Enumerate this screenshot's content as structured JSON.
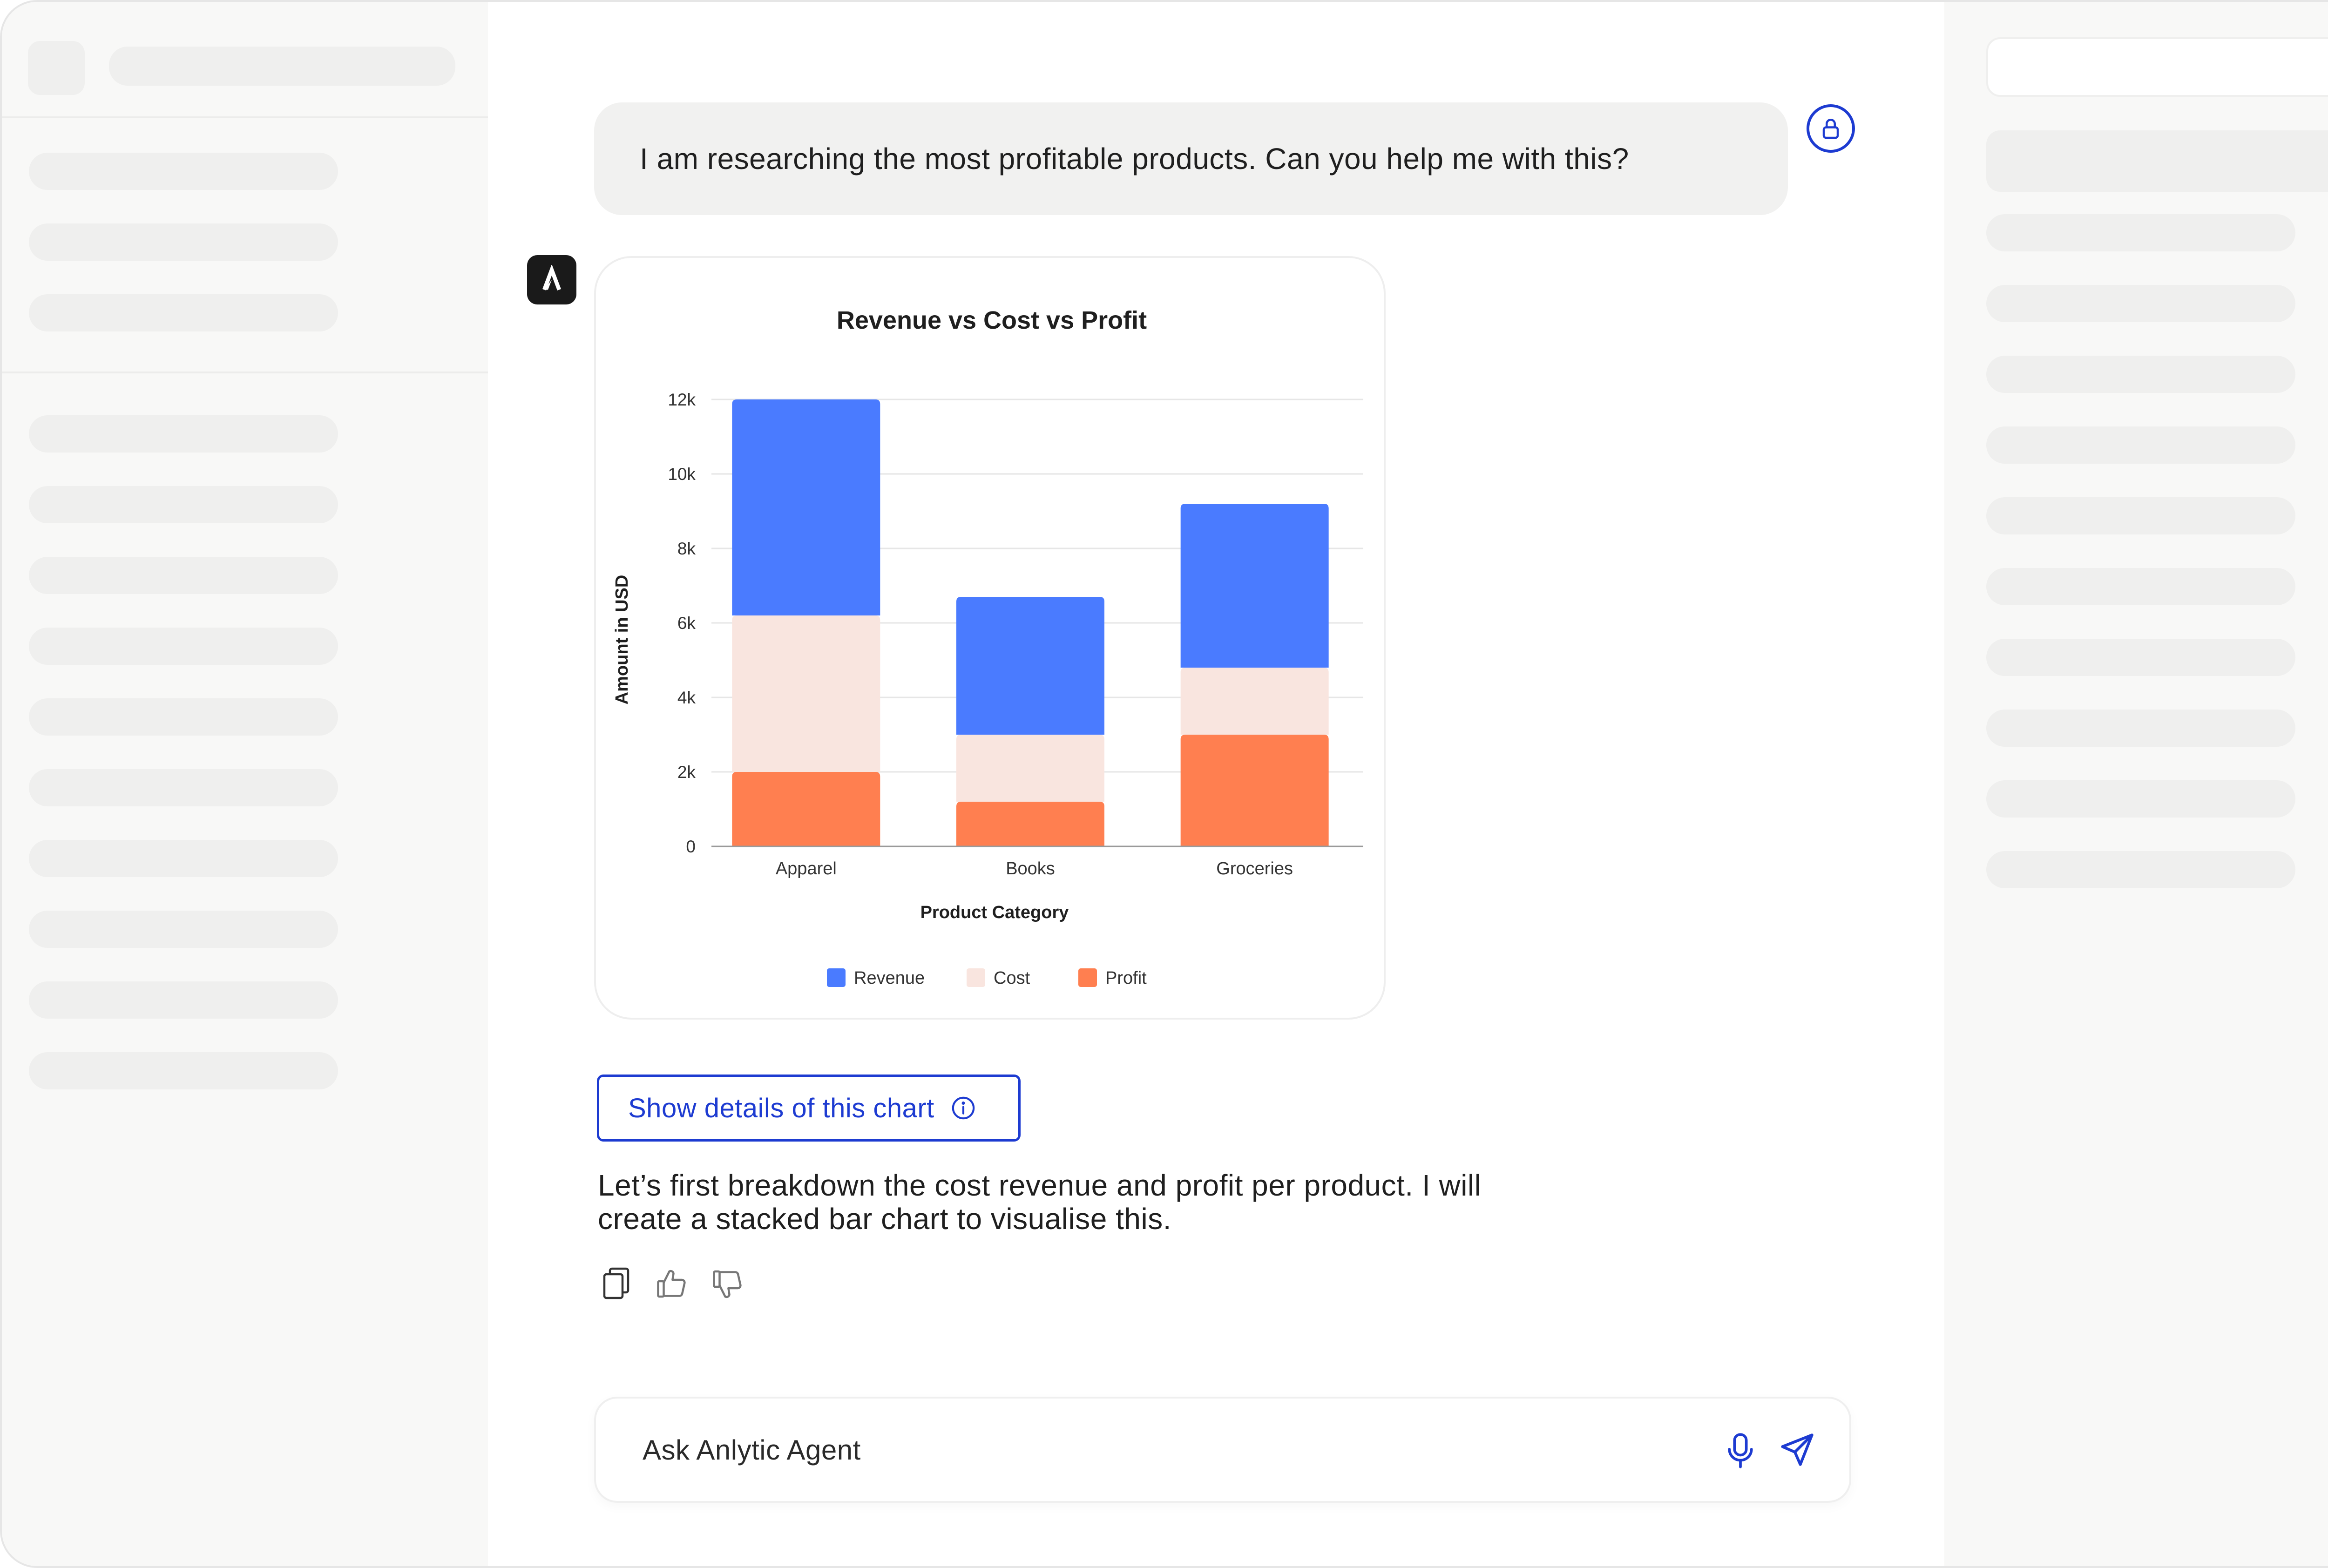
{
  "conversation": {
    "user_message": "I am researching the most profitable products. Can you help me with this?",
    "details_button_label": "Show details of this chart",
    "agent_response": "Let’s first breakdown the cost revenue and profit per product. I will create a stacked bar chart to visualise this."
  },
  "input": {
    "placeholder": "Ask Anlytic Agent"
  },
  "icons": {
    "user_avatar": "lock-user-icon",
    "agent_logo": "anlytic-logo-icon",
    "details_info": "info-icon",
    "copy": "copy-icon",
    "like": "thumbs-up-icon",
    "dislike": "thumbs-down-icon",
    "mic": "microphone-icon",
    "send": "send-icon"
  },
  "colors": {
    "accent": "#1d3bd1",
    "revenue": "#4a7bff",
    "cost": "#f9e5df",
    "profit": "#ff7f50"
  },
  "chart_data": {
    "type": "bar",
    "stacked": true,
    "title": "Revenue vs Cost vs Profit",
    "xlabel": "Product Category",
    "ylabel": "Amount in USD",
    "categories": [
      "Apparel",
      "Books",
      "Groceries"
    ],
    "series": [
      {
        "name": "Profit",
        "values": [
          2000,
          1200,
          3000
        ]
      },
      {
        "name": "Cost",
        "values": [
          4200,
          1800,
          1800
        ]
      },
      {
        "name": "Revenue",
        "values": [
          5800,
          3700,
          4400
        ]
      }
    ],
    "legend_order": [
      "Revenue",
      "Cost",
      "Profit"
    ],
    "ylim": [
      0,
      12000
    ],
    "yticks": [
      0,
      2000,
      4000,
      6000,
      8000,
      10000,
      12000
    ],
    "ytick_labels": [
      "0",
      "2k",
      "4k",
      "6k",
      "8k",
      "10k",
      "12k"
    ],
    "grid": true,
    "legend_position": "bottom"
  }
}
